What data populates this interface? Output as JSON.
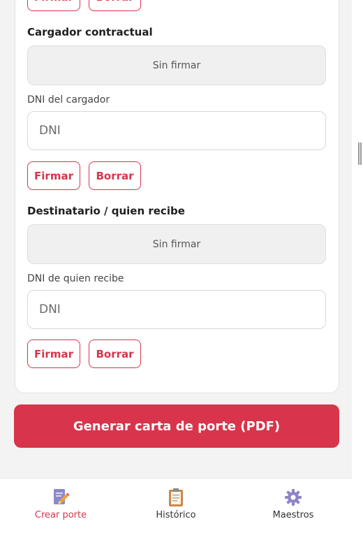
{
  "signatures": [
    {
      "title": "Cargador contractual",
      "status": "Sin firmar",
      "dni_label": "DNI del cargador",
      "dni_placeholder": "DNI",
      "sign_label": "Firmar",
      "clear_label": "Borrar"
    },
    {
      "title": "Destinatario / quien recibe",
      "status": "Sin firmar",
      "dni_label": "DNI de quien recibe",
      "dni_placeholder": "DNI",
      "sign_label": "Firmar",
      "clear_label": "Borrar"
    }
  ],
  "top_partial": {
    "sign_label": "Firmar",
    "clear_label": "Borrar"
  },
  "generate_label": "Generar carta de porte (PDF)",
  "nav": [
    {
      "label": "Crear porte",
      "icon": "pencil-document-icon",
      "active": true
    },
    {
      "label": "Histórico",
      "icon": "clipboard-icon",
      "active": false
    },
    {
      "label": "Maestros",
      "icon": "gear-icon",
      "active": false
    }
  ],
  "colors": {
    "accent": "#d8354d",
    "background": "#f4f3f3"
  }
}
